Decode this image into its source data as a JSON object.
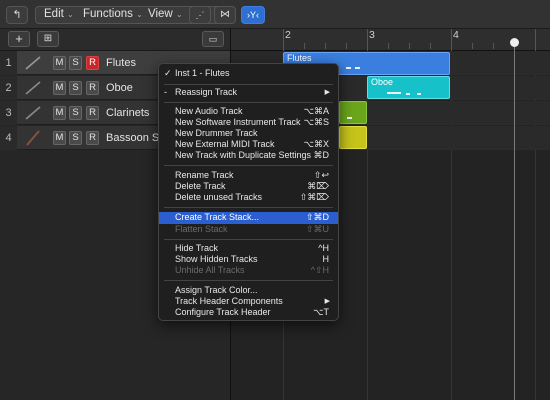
{
  "toolbar": {
    "edit": "Edit",
    "functions": "Functions",
    "view": "View"
  },
  "tracks": [
    {
      "num": "1",
      "m": "M",
      "s": "S",
      "r": "R",
      "name": "Flutes",
      "rec": true
    },
    {
      "num": "2",
      "m": "M",
      "s": "S",
      "r": "R",
      "name": "Oboe",
      "rec": false
    },
    {
      "num": "3",
      "m": "M",
      "s": "S",
      "r": "R",
      "name": "Clarinets",
      "rec": false
    },
    {
      "num": "4",
      "m": "M",
      "s": "S",
      "r": "R",
      "name": "Bassoon Solo",
      "rec": false
    }
  ],
  "ruler": {
    "bars": [
      "2",
      "3",
      "4"
    ]
  },
  "regions": [
    {
      "name": "Flutes",
      "color": "#3a7fe0"
    },
    {
      "name": "Oboe",
      "color": "#16c1c9"
    },
    {
      "name": "",
      "color": "#6aa51b"
    },
    {
      "name": "",
      "color": "#c6c31a"
    }
  ],
  "menu": {
    "inst": "Inst 1 - Flutes",
    "reassign": "Reassign Track",
    "new_audio": {
      "label": "New Audio Track",
      "sc": "⌥⌘A"
    },
    "new_sw": {
      "label": "New Software Instrument Track",
      "sc": "⌥⌘S"
    },
    "new_drummer": {
      "label": "New Drummer Track",
      "sc": ""
    },
    "new_ext": {
      "label": "New External MIDI Track",
      "sc": "⌥⌘X"
    },
    "new_dup": {
      "label": "New Track with Duplicate Settings",
      "sc": "⌘D"
    },
    "rename": {
      "label": "Rename Track",
      "sc": "⇧↩"
    },
    "delete": {
      "label": "Delete Track",
      "sc": "⌘⌦"
    },
    "delete_unused": {
      "label": "Delete unused Tracks",
      "sc": "⇧⌘⌦"
    },
    "create_stack": {
      "label": "Create Track Stack...",
      "sc": "⇧⌘D"
    },
    "flatten_stack": {
      "label": "Flatten Stack",
      "sc": "⇧⌘U"
    },
    "hide": {
      "label": "Hide Track",
      "sc": "^H"
    },
    "show_hidden": {
      "label": "Show Hidden Tracks",
      "sc": "H"
    },
    "unhide_all": {
      "label": "Unhide All Tracks",
      "sc": "^⇧H"
    },
    "assign_color": {
      "label": "Assign Track Color...",
      "sc": ""
    },
    "header_components": {
      "label": "Track Header Components",
      "sc": ""
    },
    "configure_header": {
      "label": "Configure Track Header",
      "sc": "⌥T"
    }
  }
}
